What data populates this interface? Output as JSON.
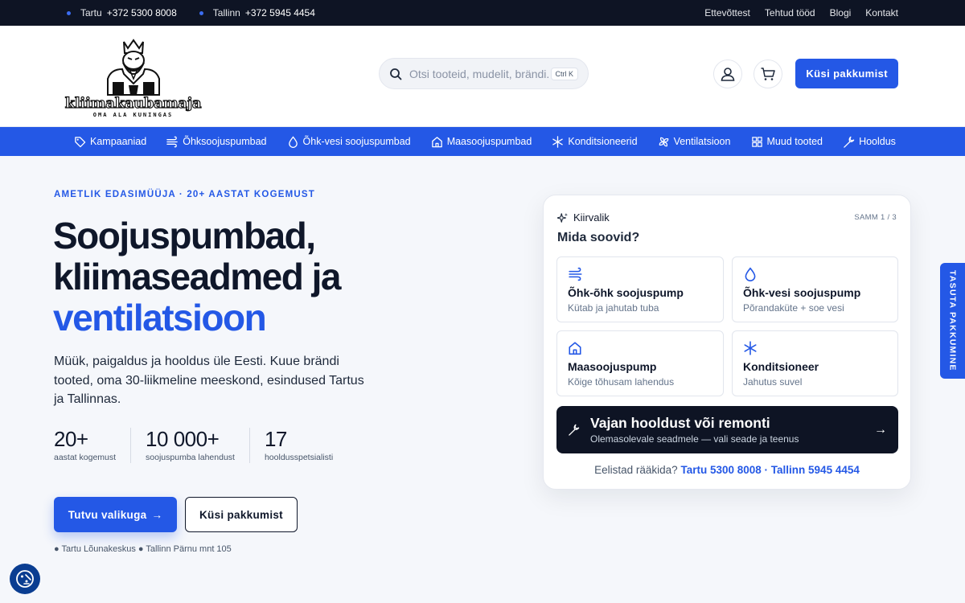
{
  "topbar": {
    "locations": [
      {
        "city": "Tartu",
        "phone": "+372 5300 8008"
      },
      {
        "city": "Tallinn",
        "phone": "+372 5945 4454"
      }
    ],
    "links": [
      "Ettevõttest",
      "Tehtud tööd",
      "Blogi",
      "Kontakt"
    ]
  },
  "header": {
    "logo": {
      "wordmark": "kliimakaubamaja",
      "slogan": "OMA ALA KUNINGAS",
      "icon": "king-mascot-logo"
    },
    "search": {
      "placeholder": "Otsi tooteid, mudelit, brändi...",
      "shortcut": "Ctrl K"
    },
    "cta_label": "Küsi pakkumist"
  },
  "nav": [
    {
      "label": "Kampaaniad",
      "icon": "tag-icon"
    },
    {
      "label": "Õhksoojuspumbad",
      "icon": "wind-icon"
    },
    {
      "label": "Õhk-vesi soojuspumbad",
      "icon": "droplet-icon"
    },
    {
      "label": "Maasoojuspumbad",
      "icon": "home-icon"
    },
    {
      "label": "Konditsioneerid",
      "icon": "snowflake-icon"
    },
    {
      "label": "Ventilatsioon",
      "icon": "fan-icon"
    },
    {
      "label": "Muud tooted",
      "icon": "grid-icon"
    },
    {
      "label": "Hooldus",
      "icon": "wrench-icon"
    }
  ],
  "hero": {
    "eyebrow": "AMETLIK EDASIMÜÜJA · 20+ AASTAT KOGEMUST",
    "title_line1": "Soojuspumbad,",
    "title_line2": "kliimaseadmed ja",
    "title_accent": "ventilatsioon",
    "lead": "Müük, paigaldus ja hooldus üle Eesti. Kuue brändi tooted, oma 30-liikmeline meeskond, esindused Tartus ja Tallinnas.",
    "stats": [
      {
        "value": "20+",
        "label": "aastat kogemust"
      },
      {
        "value": "10 000+",
        "label": "soojuspumba lahendust"
      },
      {
        "value": "17",
        "label": "hooldusspetsialisti"
      }
    ],
    "cta_primary": "Tutvu valikuga",
    "cta_primary_arrow": "→",
    "cta_secondary": "Küsi pakkumist",
    "locations": "● Tartu Lõunakeskus ● Tallinn Pärnu mnt 105"
  },
  "quick": {
    "title": "Kiirvalik",
    "step": "SAMM 1 / 3",
    "question": "Mida soovid?",
    "options": [
      {
        "title": "Õhk-õhk soojuspump",
        "subtitle": "Kütab ja jahutab tuba",
        "icon": "wind-icon"
      },
      {
        "title": "Õhk-vesi soojuspump",
        "subtitle": "Põrandaküte + soe vesi",
        "icon": "droplet-icon"
      },
      {
        "title": "Maasoojuspump",
        "subtitle": "Kõige tõhusam lahendus",
        "icon": "home-icon"
      },
      {
        "title": "Konditsioneer",
        "subtitle": "Jahutus suvel",
        "icon": "snowflake-icon"
      }
    ],
    "service": {
      "title": "Vajan hooldust või remonti",
      "subtitle": "Olemasolevale seadmele — vali seade ja teenus",
      "arrow": "→"
    },
    "phones_prefix": "Eelistad rääkida?",
    "phone_tartu": "Tartu 5300 8008",
    "phone_sep": " · ",
    "phone_tallinn": "Tallinn 5945 4454"
  },
  "sidetab": "TASUTA PAKKUMINE",
  "colors": {
    "brand": "#2458e6",
    "dark": "#0e1424",
    "background": "#f5f7fb"
  }
}
